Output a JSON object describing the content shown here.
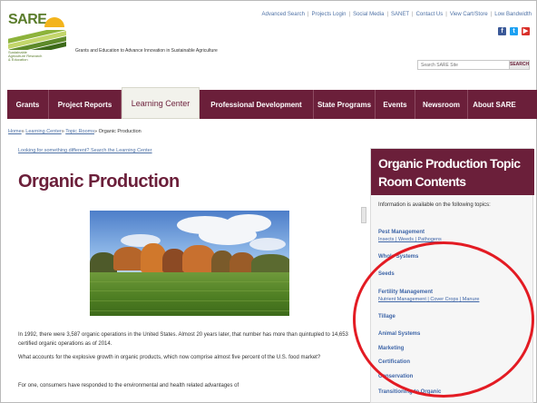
{
  "header": {
    "logo_text": "SARE",
    "logo_subtitle": "Sustainable Agriculture Research & Education",
    "tagline": "Grants and Education to Advance Innovation in Sustainable Agriculture",
    "top_links": [
      "Advanced Search",
      "Projects Login",
      "Social Media",
      "SANET",
      "Contact Us",
      "View Cart/Store",
      "Low Bandwidth"
    ],
    "social_icons": [
      "facebook-icon",
      "twitter-icon",
      "youtube-icon"
    ],
    "search_placeholder": "Search SARE Site",
    "search_button": "SEARCH"
  },
  "nav": {
    "items": [
      "Grants",
      "Project Reports",
      "Learning Center",
      "Professional Development",
      "State Programs",
      "Events",
      "Newsroom",
      "About SARE"
    ],
    "active": "Learning Center"
  },
  "breadcrumb": {
    "items": [
      "Home",
      "Learning Center",
      "Topic Rooms",
      "Organic Production"
    ],
    "separator": "»"
  },
  "main": {
    "looking_link": "Looking for something different? Search the Learning Center",
    "title": "Organic Production",
    "paragraphs": [
      "In 1992, there were 3,587 organic operations in the United States. Almost 20 years later, that number has more than quintupled to 14,653 certified organic operations as of 2014.",
      "What accounts for the explosive growth in organic products, which now comprise almost five percent of the U.S. food market?",
      "For one, consumers have responded to the environmental and health related advantages of"
    ]
  },
  "sidebar": {
    "title": "Organic Production Topic Room Contents",
    "intro": "Information is available on the following topics:",
    "topics": [
      {
        "label": "Pest Management",
        "sub": [
          "Insects",
          "Weeds",
          "Pathogens"
        ]
      },
      {
        "label": "Whole Systems"
      },
      {
        "label": "Seeds"
      },
      {
        "label": "Fertility Management",
        "sub": [
          "Nutrient Management",
          "Cover Crops",
          "Manure"
        ]
      },
      {
        "label": "Tillage"
      },
      {
        "label": "Animal Systems"
      },
      {
        "label": "Marketing"
      },
      {
        "label": "Certification"
      },
      {
        "label": "Conservation"
      },
      {
        "label": "Transitioning to Organic"
      }
    ]
  },
  "colors": {
    "brand": "#6b1f3a",
    "link": "#4f72a6",
    "highlight_circle": "#e31b23"
  }
}
